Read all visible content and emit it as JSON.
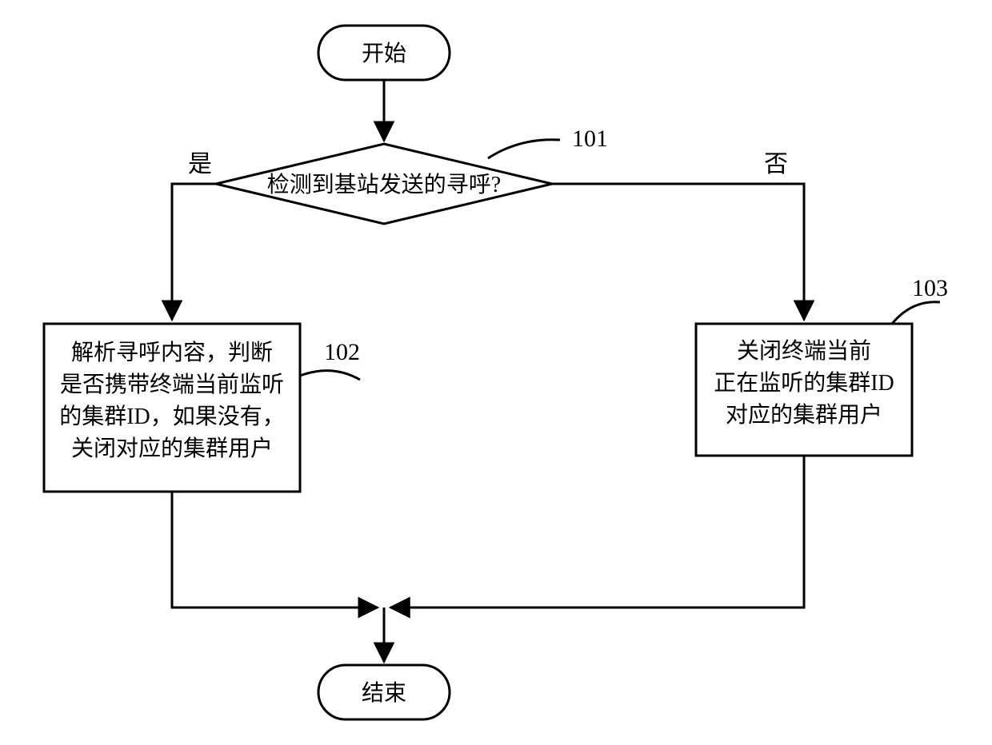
{
  "chart_data": {
    "type": "flowchart",
    "nodes": {
      "start": {
        "label": "开始",
        "shape": "terminator"
      },
      "decision": {
        "label": "检测到基站发送的寻呼?",
        "shape": "decision",
        "ref": "101"
      },
      "proc_yes": {
        "label_lines": [
          "解析寻呼内容，判断",
          "是否携带终端当前监听",
          "的集群ID，如果没有，",
          "关闭对应的集群用户"
        ],
        "shape": "process",
        "ref": "102"
      },
      "proc_no": {
        "label_lines": [
          "关闭终端当前",
          "正在监听的集群ID",
          "对应的集群用户"
        ],
        "shape": "process",
        "ref": "103"
      },
      "end": {
        "label": "结束",
        "shape": "terminator"
      }
    },
    "edges": [
      {
        "from": "start",
        "to": "decision"
      },
      {
        "from": "decision",
        "to": "proc_yes",
        "label": "是"
      },
      {
        "from": "decision",
        "to": "proc_no",
        "label": "否"
      },
      {
        "from": "proc_yes",
        "to": "end"
      },
      {
        "from": "proc_no",
        "to": "end"
      }
    ]
  },
  "labels": {
    "start": "开始",
    "decision": "检测到基站发送的寻呼?",
    "yes": "是",
    "no": "否",
    "end": "结束",
    "ref101": "101",
    "ref102": "102",
    "ref103": "103",
    "proc_yes_l1": "解析寻呼内容，判断",
    "proc_yes_l2": "是否携带终端当前监听",
    "proc_yes_l3": "的集群ID，如果没有，",
    "proc_yes_l4": "关闭对应的集群用户",
    "proc_no_l1": "关闭终端当前",
    "proc_no_l2": "正在监听的集群ID",
    "proc_no_l3": "对应的集群用户"
  }
}
